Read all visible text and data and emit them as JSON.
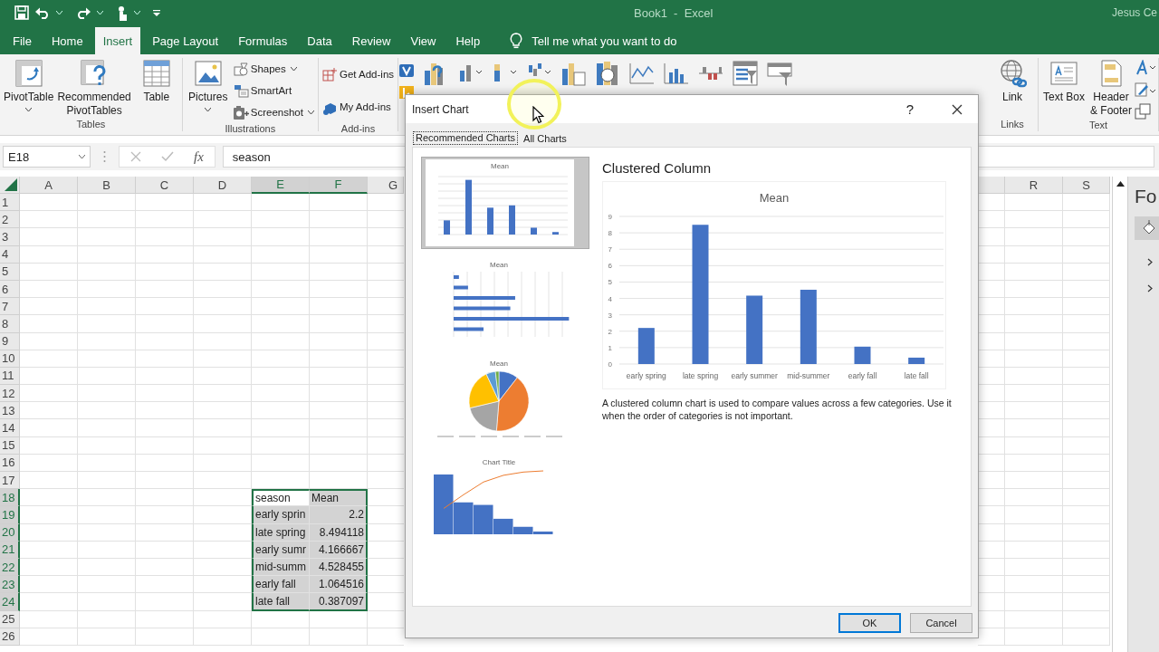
{
  "title_bar": {
    "title": "Book1  -  Excel",
    "user": "Jesus Ce"
  },
  "tabs": [
    {
      "label": "File",
      "selected": false
    },
    {
      "label": "Home",
      "selected": false
    },
    {
      "label": "Insert",
      "selected": true
    },
    {
      "label": "Page Layout",
      "selected": false
    },
    {
      "label": "Formulas",
      "selected": false
    },
    {
      "label": "Data",
      "selected": false
    },
    {
      "label": "Review",
      "selected": false
    },
    {
      "label": "View",
      "selected": false
    },
    {
      "label": "Help",
      "selected": false
    }
  ],
  "tell_me": "Tell me what you want to do",
  "ribbon": {
    "left_groups": [
      {
        "label": "Tables",
        "items": [
          {
            "kind": "large",
            "label": "PivotTable",
            "menu": true
          },
          {
            "kind": "large",
            "label": "Recommended PivotTables",
            "menu": false
          },
          {
            "kind": "large",
            "label": "Table",
            "menu": false
          }
        ]
      },
      {
        "label": "Illustrations",
        "items": [
          {
            "kind": "large",
            "label": "Pictures",
            "menu": true
          },
          {
            "kind": "small",
            "label": "Shapes",
            "menu": true
          },
          {
            "kind": "small",
            "label": "SmartArt",
            "menu": false
          },
          {
            "kind": "small",
            "label": "Screenshot",
            "menu": true
          }
        ]
      },
      {
        "label": "Add-ins",
        "items": [
          {
            "kind": "small",
            "label": "Get Add-ins",
            "menu": false
          },
          {
            "kind": "small",
            "label": "My Add-ins",
            "menu": false
          }
        ]
      }
    ],
    "right_groups": [
      {
        "label": "Links",
        "items": [
          {
            "kind": "large",
            "label": "Link",
            "menu": false
          }
        ]
      },
      {
        "label": "Text",
        "items": [
          {
            "kind": "large",
            "label": "Text Box",
            "menu": false
          },
          {
            "kind": "large",
            "label": "Header & Footer",
            "menu": false
          },
          {
            "kind": "icons"
          }
        ]
      }
    ]
  },
  "formula_bar": {
    "name_box": "E18",
    "function_button": "fx",
    "formula": "season"
  },
  "sheet": {
    "columns": [
      {
        "label": "A",
        "selected": false
      },
      {
        "label": "B",
        "selected": false
      },
      {
        "label": "C",
        "selected": false
      },
      {
        "label": "D",
        "selected": false
      },
      {
        "label": "E",
        "selected": true
      },
      {
        "label": "F",
        "selected": true
      },
      {
        "label": "G",
        "selected": false
      }
    ],
    "right_columns": [
      {
        "label": "R",
        "selected": false
      },
      {
        "label": "S",
        "selected": false
      }
    ],
    "rows": [
      {
        "label": "1",
        "selected": false
      },
      {
        "label": "2",
        "selected": false
      },
      {
        "label": "3",
        "selected": false
      },
      {
        "label": "4",
        "selected": false
      },
      {
        "label": "5",
        "selected": false
      },
      {
        "label": "6",
        "selected": false
      },
      {
        "label": "7",
        "selected": false
      },
      {
        "label": "8",
        "selected": false
      },
      {
        "label": "9",
        "selected": false
      },
      {
        "label": "10",
        "selected": false
      },
      {
        "label": "11",
        "selected": false
      },
      {
        "label": "12",
        "selected": false
      },
      {
        "label": "13",
        "selected": false
      },
      {
        "label": "14",
        "selected": false
      },
      {
        "label": "15",
        "selected": false
      },
      {
        "label": "16",
        "selected": false
      },
      {
        "label": "17",
        "selected": false
      },
      {
        "label": "18",
        "selected": true
      },
      {
        "label": "19",
        "selected": true
      },
      {
        "label": "20",
        "selected": true
      },
      {
        "label": "21",
        "selected": true
      },
      {
        "label": "22",
        "selected": true
      },
      {
        "label": "23",
        "selected": true
      },
      {
        "label": "24",
        "selected": true
      },
      {
        "label": "25",
        "selected": false
      },
      {
        "label": "26",
        "selected": false
      }
    ],
    "data_table": {
      "selected": true,
      "rows": [
        [
          {
            "text": "season",
            "kind": "text"
          },
          {
            "text": "Mean",
            "kind": "text"
          }
        ],
        [
          {
            "text": "early sprin",
            "kind": "text"
          },
          {
            "text": "2.2",
            "kind": "number"
          }
        ],
        [
          {
            "text": "late spring",
            "kind": "text"
          },
          {
            "text": "8.494118",
            "kind": "number"
          }
        ],
        [
          {
            "text": "early sumr",
            "kind": "text"
          },
          {
            "text": "4.166667",
            "kind": "number"
          }
        ],
        [
          {
            "text": "mid-summ",
            "kind": "text"
          },
          {
            "text": "4.528455",
            "kind": "number"
          }
        ],
        [
          {
            "text": "early fall",
            "kind": "text"
          },
          {
            "text": "1.064516",
            "kind": "number"
          }
        ],
        [
          {
            "text": "late fall",
            "kind": "text"
          },
          {
            "text": "0.387097",
            "kind": "number"
          }
        ]
      ]
    }
  },
  "side_pane": {
    "title": "Fo"
  },
  "dialog": {
    "title": "Insert Chart",
    "help": "?",
    "tabs": [
      {
        "label": "Recommended Charts",
        "selected": true
      },
      {
        "label": "All Charts",
        "selected": false
      }
    ],
    "thumbnails": [
      {
        "kind": "column",
        "title": "Mean",
        "selected": true
      },
      {
        "kind": "bar",
        "title": "Mean",
        "selected": false
      },
      {
        "kind": "pie",
        "title": "Mean",
        "selected": false
      },
      {
        "kind": "pareto",
        "title": "Chart Title",
        "selected": false
      }
    ],
    "preview": {
      "heading": "Clustered Column",
      "chart_data": {
        "type": "bar",
        "title": "Mean",
        "categories": [
          "early spring",
          "late spring",
          "early summer",
          "mid-summer",
          "early fall",
          "late fall"
        ],
        "series": [
          {
            "color": "#4472c4",
            "values": [
              2.2,
              8.49,
              4.17,
              4.53,
              1.06,
              0.39
            ]
          }
        ],
        "ylim": [
          0,
          9
        ],
        "yticks": [
          0,
          1,
          2,
          3,
          4,
          5,
          6,
          7,
          8,
          9
        ],
        "grid": true
      },
      "description": "A clustered column chart is used to compare values across a few categories. Use it when the order of categories is not important."
    },
    "buttons": [
      {
        "label": "OK",
        "default": true
      },
      {
        "label": "Cancel",
        "default": false
      }
    ]
  }
}
